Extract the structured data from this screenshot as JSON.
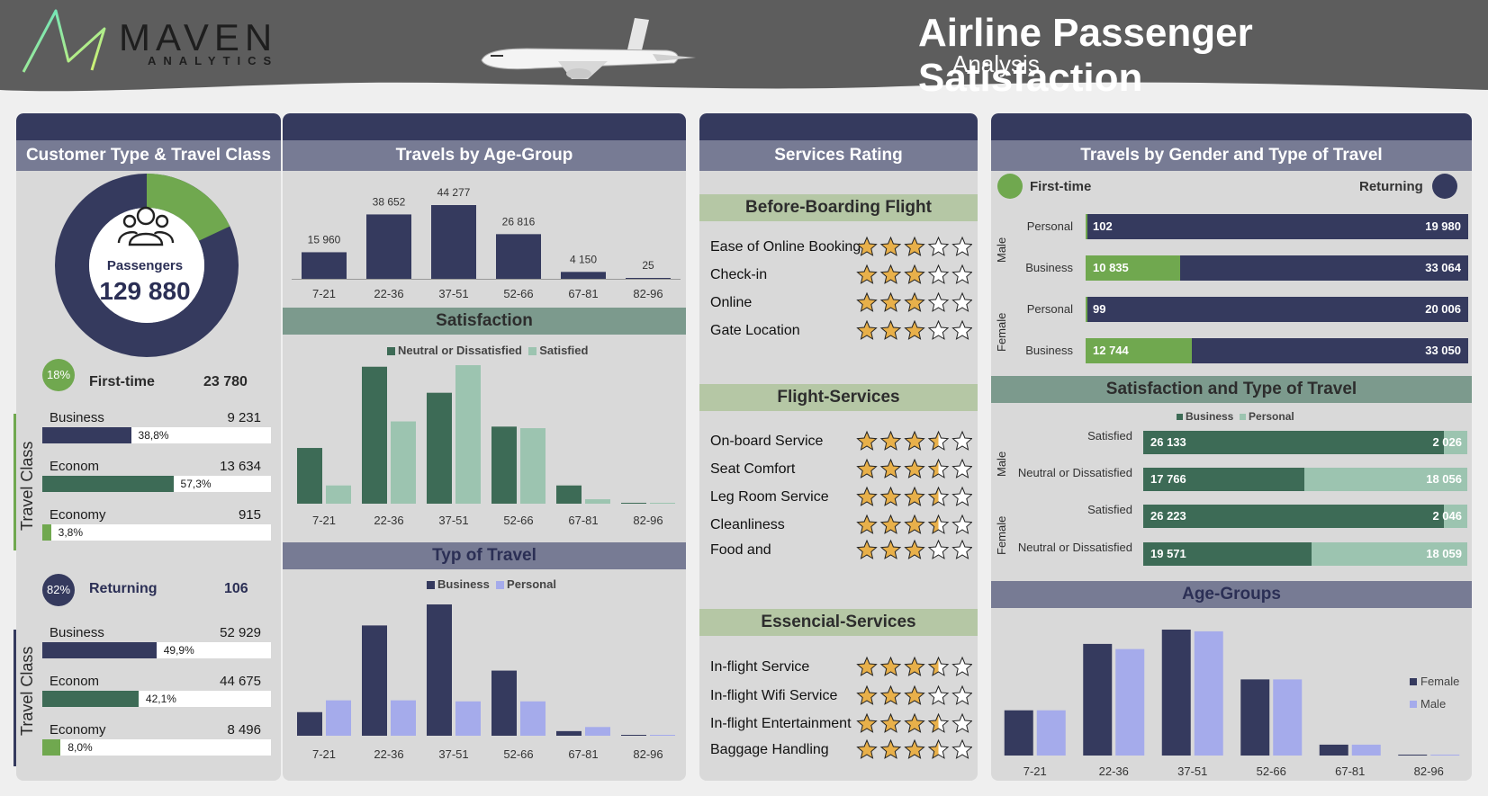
{
  "header": {
    "logo_name": "MAVEN",
    "logo_sub": "ANALYTICS",
    "title": "Airline Passenger Satisfaction",
    "subtitle": "Analysis"
  },
  "colors": {
    "navy": "#353a5e",
    "green": "#70a84f",
    "dark_teal": "#3d6b56",
    "light_teal": "#9cc4b0",
    "lavender": "#a5abeb"
  },
  "customer": {
    "title": "Customer Type & Travel Class",
    "donut_label": "Passengers",
    "total": "129 880",
    "first_time": {
      "pct": "18%",
      "label": "First-time",
      "value": "23 780",
      "classes": [
        {
          "name": "Business",
          "value": "9 231",
          "pct_label": "38,8%",
          "pct": 38.8
        },
        {
          "name": "Econom",
          "value": "13 634",
          "pct_label": "57,3%",
          "pct": 57.3
        },
        {
          "name": "Economy",
          "value": "915",
          "pct_label": "3,8%",
          "pct": 3.8
        }
      ]
    },
    "returning": {
      "pct": "82%",
      "label": "Returning",
      "value": "106",
      "classes": [
        {
          "name": "Business",
          "value": "52 929",
          "pct_label": "49,9%",
          "pct": 49.9
        },
        {
          "name": "Econom",
          "value": "44 675",
          "pct_label": "42,1%",
          "pct": 42.1
        },
        {
          "name": "Economy",
          "value": "8 496",
          "pct_label": "8,0%",
          "pct": 8.0
        }
      ]
    },
    "travel_class_label": "Travel Class"
  },
  "age": {
    "title": "Travels by Age-Group",
    "satisfaction_title": "Satisfaction",
    "type_title": "Typ of Travel"
  },
  "services": {
    "title": "Services Rating",
    "groups": [
      {
        "title": "Before-Boarding Flight",
        "items": [
          {
            "label": "Ease of Online Booking",
            "rating": 3
          },
          {
            "label": "Check-in",
            "rating": 3
          },
          {
            "label": "Online",
            "rating": 3
          },
          {
            "label": "Gate Location",
            "rating": 3
          }
        ]
      },
      {
        "title": "Flight-Services",
        "items": [
          {
            "label": "On-board Service",
            "rating": 3.5
          },
          {
            "label": "Seat Comfort",
            "rating": 3.5
          },
          {
            "label": "Leg Room Service",
            "rating": 3.5
          },
          {
            "label": "Cleanliness",
            "rating": 3.5
          },
          {
            "label": "Food and",
            "rating": 3
          }
        ]
      },
      {
        "title": "Essencial-Services",
        "items": [
          {
            "label": "In-flight Service",
            "rating": 3.5
          },
          {
            "label": "In-flight Wifi Service",
            "rating": 3
          },
          {
            "label": "In-flight Entertainment",
            "rating": 3.5
          },
          {
            "label": "Baggage Handling",
            "rating": 3.5
          }
        ]
      }
    ]
  },
  "gender": {
    "title": "Travels by Gender and Type of Travel",
    "legend_first": "First-time",
    "legend_returning": "Returning",
    "sat_title": "Satisfaction and Type of Travel",
    "age_title": "Age-Groups",
    "male_label": "Male",
    "female_label": "Female"
  },
  "chart_data": [
    {
      "type": "bar",
      "title": "Travels by Age-Group",
      "categories": [
        "7-21",
        "22-36",
        "37-51",
        "52-66",
        "67-81",
        "82-96"
      ],
      "values": [
        15960,
        38652,
        44277,
        26816,
        4150,
        25
      ],
      "value_labels": [
        "15 960",
        "38 652",
        "44 277",
        "26 816",
        "4 150",
        "25"
      ]
    },
    {
      "type": "bar",
      "title": "Satisfaction",
      "categories": [
        "7-21",
        "22-36",
        "37-51",
        "52-66",
        "67-81",
        "82-96"
      ],
      "series": [
        {
          "name": "Neutral or Dissatisfied",
          "values": [
            10700,
            26300,
            21300,
            14800,
            3500,
            20
          ]
        },
        {
          "name": "Satisfied",
          "values": [
            3500,
            15800,
            26600,
            14500,
            850,
            8
          ]
        }
      ]
    },
    {
      "type": "bar",
      "title": "Typ of Travel",
      "categories": [
        "7-21",
        "22-36",
        "37-51",
        "52-66",
        "67-81",
        "82-96"
      ],
      "series": [
        {
          "name": "Business",
          "values": [
            4600,
            21500,
            25600,
            12700,
            900,
            10
          ]
        },
        {
          "name": "Personal",
          "values": [
            6900,
            6900,
            6700,
            6700,
            1700,
            12
          ]
        }
      ]
    },
    {
      "type": "bar",
      "title": "Travels by Gender and Type of Travel",
      "orientation": "horizontal",
      "rows": [
        {
          "gender": "Male",
          "label": "Personal",
          "first_time": 102,
          "returning": 19980,
          "first_label": "102",
          "returning_label": "19 980"
        },
        {
          "gender": "Male",
          "label": "Business",
          "first_time": 10835,
          "returning": 33064,
          "first_label": "10 835",
          "returning_label": "33 064"
        },
        {
          "gender": "Female",
          "label": "Personal",
          "first_time": 99,
          "returning": 20006,
          "first_label": "99",
          "returning_label": "20 006"
        },
        {
          "gender": "Female",
          "label": "Business",
          "first_time": 12744,
          "returning": 33050,
          "first_label": "12 744",
          "returning_label": "33 050"
        }
      ]
    },
    {
      "type": "bar",
      "title": "Satisfaction and Type of Travel",
      "orientation": "horizontal",
      "legend": [
        "Business",
        "Personal"
      ],
      "rows": [
        {
          "gender": "Male",
          "label": "Satisfied",
          "business": 26133,
          "personal": 2026,
          "business_label": "26 133",
          "personal_label": "2 026"
        },
        {
          "gender": "Male",
          "label": "Neutral or Dissatisfied",
          "business": 17766,
          "personal": 18056,
          "business_label": "17 766",
          "personal_label": "18 056"
        },
        {
          "gender": "Female",
          "label": "Satisfied",
          "business": 26223,
          "personal": 2046,
          "business_label": "26 223",
          "personal_label": "2 046"
        },
        {
          "gender": "Female",
          "label": "Neutral or Dissatisfied",
          "business": 19571,
          "personal": 18059,
          "business_label": "19 571",
          "personal_label": "18 059"
        }
      ]
    },
    {
      "type": "bar",
      "title": "Age-Groups",
      "categories": [
        "7-21",
        "22-36",
        "37-51",
        "52-66",
        "67-81",
        "82-96"
      ],
      "series": [
        {
          "name": "Female",
          "values": [
            7900,
            19500,
            22000,
            13300,
            1900,
            10
          ]
        },
        {
          "name": "Male",
          "values": [
            7900,
            18600,
            21700,
            13300,
            1900,
            15
          ]
        }
      ]
    }
  ]
}
